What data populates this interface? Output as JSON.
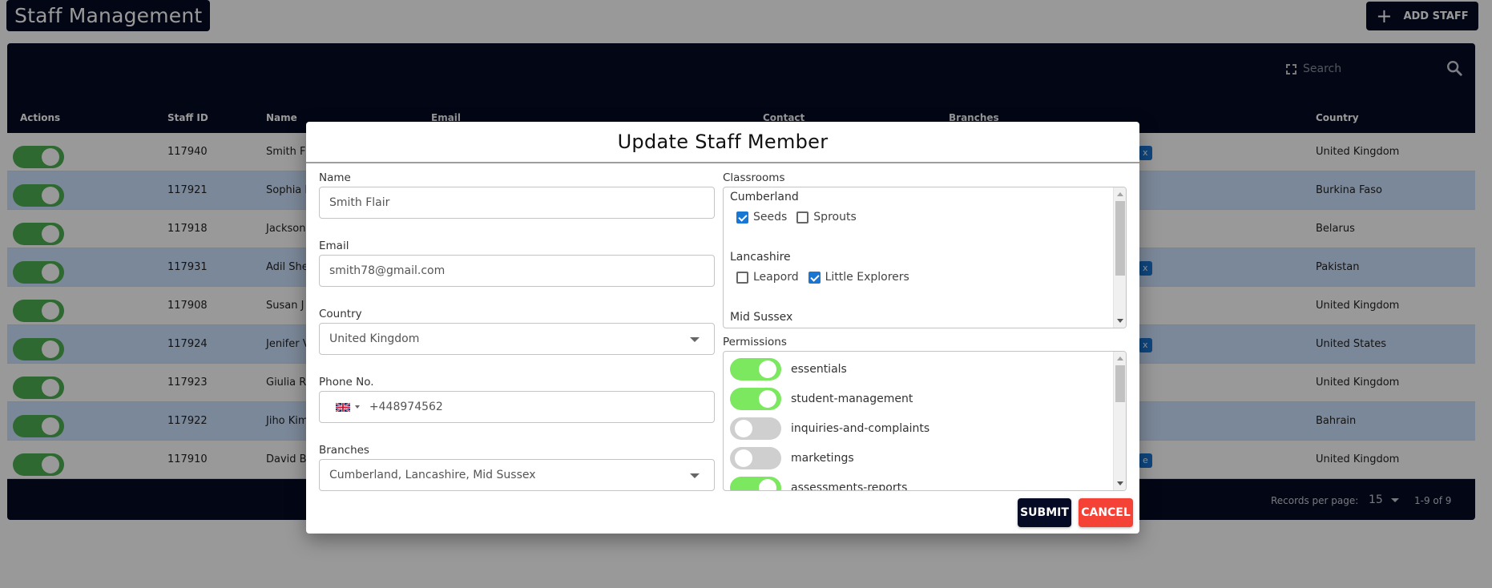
{
  "page": {
    "title": "Staff Management",
    "add_staff_label": "ADD STAFF",
    "search_placeholder": "Search"
  },
  "table": {
    "headers": {
      "actions": "Actions",
      "staff_id": "Staff ID",
      "name": "Name",
      "email": "Email",
      "contact": "Contact",
      "branches": "Branches",
      "country": "Country"
    },
    "rows": [
      {
        "active": true,
        "staff_id": "117940",
        "name": "Smith Fl",
        "branch_chip": "x",
        "country": "United Kingdom"
      },
      {
        "active": true,
        "staff_id": "117921",
        "name": "Sophia K",
        "branch_chip": "",
        "country": "Burkina Faso"
      },
      {
        "active": true,
        "staff_id": "117918",
        "name": "Jackson",
        "branch_chip": "",
        "country": "Belarus"
      },
      {
        "active": true,
        "staff_id": "117931",
        "name": "Adil She",
        "branch_chip": "x",
        "country": "Pakistan"
      },
      {
        "active": true,
        "staff_id": "117908",
        "name": "Susan J",
        "branch_chip": "",
        "country": "United Kingdom"
      },
      {
        "active": true,
        "staff_id": "117924",
        "name": "Jenifer V",
        "branch_chip": "x",
        "country": "United States"
      },
      {
        "active": true,
        "staff_id": "117923",
        "name": "Giulia Ro",
        "branch_chip": "",
        "country": "United Kingdom"
      },
      {
        "active": true,
        "staff_id": "117922",
        "name": "Jiho Kim",
        "branch_chip": "",
        "country": "Bahrain"
      },
      {
        "active": true,
        "staff_id": "117910",
        "name": "David Br",
        "branch_chip": "e",
        "country": "United Kingdom"
      }
    ],
    "footer": {
      "records_per_page_label": "Records per page:",
      "records_per_page_value": "15",
      "range": "1-9 of 9"
    }
  },
  "modal": {
    "title": "Update Staff Member",
    "name_label": "Name",
    "name_value": "Smith Flair",
    "email_label": "Email",
    "email_value": "smith78@gmail.com",
    "country_label": "Country",
    "country_value": "United Kingdom",
    "phone_label": "Phone No.",
    "phone_value": "+448974562",
    "phone_flag": "uk-flag-icon",
    "branches_label": "Branches",
    "branches_value": "Cumberland, Lancashire, Mid Sussex",
    "classrooms_label": "Classrooms",
    "classrooms": [
      {
        "branch": "Cumberland",
        "rooms": [
          {
            "label": "Seeds",
            "checked": true
          },
          {
            "label": "Sprouts",
            "checked": false
          }
        ]
      },
      {
        "branch": "Lancashire",
        "rooms": [
          {
            "label": "Leapord",
            "checked": false
          },
          {
            "label": "Little Explorers",
            "checked": true
          }
        ]
      },
      {
        "branch": "Mid Sussex",
        "rooms": []
      }
    ],
    "permissions_label": "Permissions",
    "permissions": [
      {
        "label": "essentials",
        "enabled": true
      },
      {
        "label": "student-management",
        "enabled": true
      },
      {
        "label": "inquiries-and-complaints",
        "enabled": false
      },
      {
        "label": "marketings",
        "enabled": false
      },
      {
        "label": "assessments-reports",
        "enabled": true
      }
    ],
    "submit_label": "SUBMIT",
    "cancel_label": "CANCEL"
  },
  "colors": {
    "navy": "#050b24",
    "cancel_red": "#f44336",
    "toggle_green": "#4caf50",
    "perm_green": "#7be85f",
    "checkbox_blue": "#1976d2"
  }
}
